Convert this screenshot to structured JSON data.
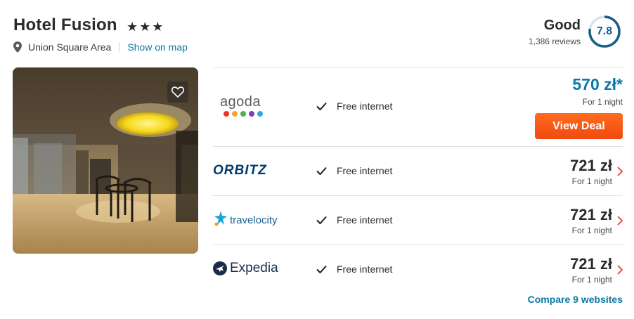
{
  "hotel": {
    "name": "Hotel Fusion",
    "stars": "★★★",
    "location": "Union Square Area",
    "map_link": "Show on map"
  },
  "rating": {
    "label": "Good",
    "reviews": "1,386 reviews",
    "score": "7.8"
  },
  "deals": [
    {
      "provider": "agoda",
      "amenity": "Free internet",
      "price": "570 zł*",
      "per_night": "For 1 night",
      "button": "View Deal"
    },
    {
      "provider": "ORBITZ",
      "amenity": "Free internet",
      "price": "721 zł",
      "per_night": "For 1 night"
    },
    {
      "provider": "travelocity",
      "amenity": "Free internet",
      "price": "721 zł",
      "per_night": "For 1 night"
    },
    {
      "provider": "Expedia",
      "amenity": "Free internet",
      "price": "721 zł",
      "per_night": "For 1 night"
    }
  ],
  "compare_link": "Compare 9 websites",
  "colors": {
    "link_blue": "#0a78a9",
    "deal_orange": "#f04a0f",
    "score_ring": "#1a5f85"
  },
  "icons": [
    "map-pin-icon",
    "heart-icon",
    "check-icon",
    "chevron-right-icon"
  ]
}
